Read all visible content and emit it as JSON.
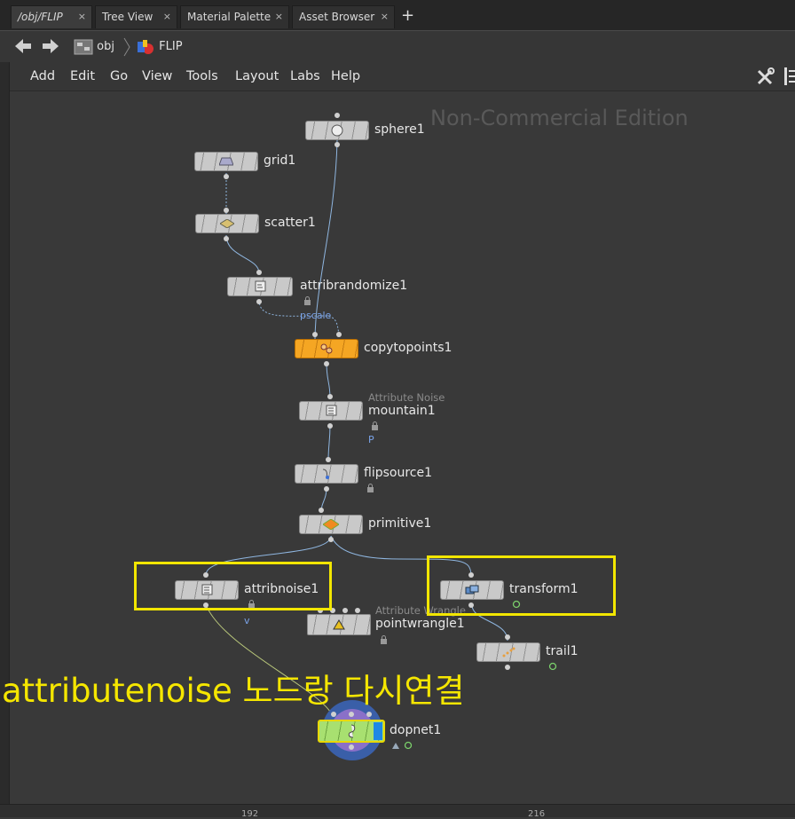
{
  "tabs": [
    {
      "label": "/obj/FLIP",
      "active": true
    },
    {
      "label": "Tree View",
      "active": false
    },
    {
      "label": "Material Palette",
      "active": false
    },
    {
      "label": "Asset Browser",
      "active": false
    }
  ],
  "tab_close_glyph": "×",
  "add_tab_glyph": "+",
  "path": {
    "obj_label": "obj",
    "network_label": "FLIP"
  },
  "menu": [
    "Add",
    "Edit",
    "Go",
    "View",
    "Tools",
    "Layout",
    "Labs",
    "Help"
  ],
  "watermark": "Non-Commercial Edition",
  "nodes": {
    "sphere1": {
      "label": "sphere1",
      "icon": "sphere-icon"
    },
    "grid1": {
      "label": "grid1",
      "icon": "grid-icon"
    },
    "scatter1": {
      "label": "scatter1",
      "icon": "scatter-icon"
    },
    "attribrandomize1": {
      "label": "attribrandomize1",
      "icon": "attribrandomize-icon",
      "attr": "pscale"
    },
    "copytopoints1": {
      "label": "copytopoints1",
      "icon": "copy-icon",
      "color": "#f5a623"
    },
    "mountain1": {
      "label": "mountain1",
      "type_label": "Attribute Noise",
      "attr": "P"
    },
    "flipsource1": {
      "label": "flipsource1"
    },
    "primitive1": {
      "label": "primitive1"
    },
    "attribnoise1": {
      "label": "attribnoise1",
      "attr": "v"
    },
    "pointwrangle1": {
      "label": "pointwrangle1",
      "type_label": "Attribute Wrangle"
    },
    "transform1": {
      "label": "transform1"
    },
    "trail1": {
      "label": "trail1"
    },
    "dopnet1": {
      "label": "dopnet1",
      "color": "#a8e070"
    }
  },
  "annotation": "attributenoise 노드랑 다시연결",
  "highlight_color": "#f2e600",
  "bottom_ticks": [
    "192",
    "216"
  ]
}
